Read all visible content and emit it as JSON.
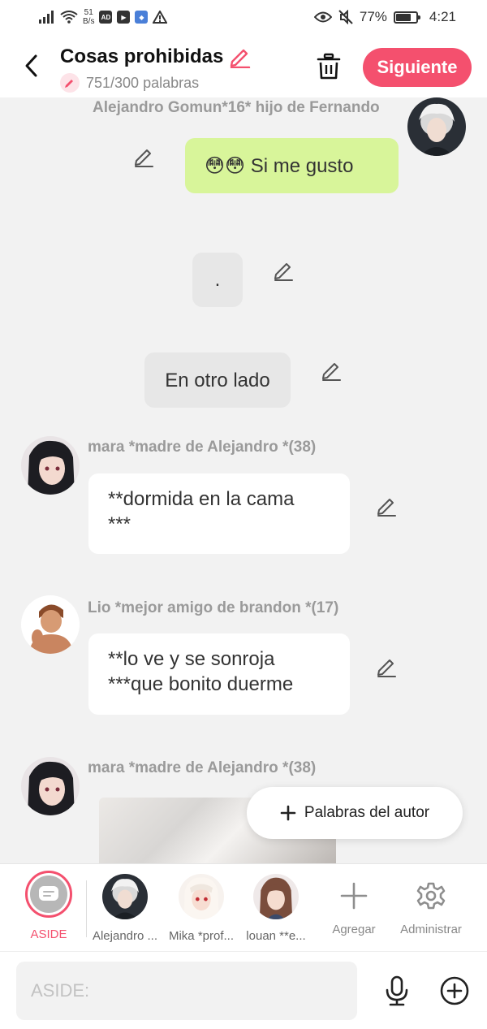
{
  "status_bar": {
    "net_speed_value": "51",
    "net_speed_unit": "B/s",
    "app_icon_1": "AD",
    "battery": "77%",
    "time": "4:21"
  },
  "header": {
    "title": "Cosas prohibidas",
    "word_count": "751/300 palabras",
    "next_label": "Siguiente"
  },
  "messages": [
    {
      "speaker": "Alejandro Gomun*16* hijo de Fernando",
      "text": "😳😳 Si me gusto"
    },
    {
      "text": "."
    },
    {
      "text": "En otro lado"
    },
    {
      "speaker": "mara *madre de Alejandro *(38)",
      "line1": "**dormida en la cama",
      "line2": "***"
    },
    {
      "speaker": "Lio *mejor amigo de brandon *(17)",
      "line1": "**lo ve y se sonroja",
      "line2": "***que bonito duerme"
    },
    {
      "speaker": "mara *madre de Alejandro *(38)"
    }
  ],
  "fab": {
    "label": "Palabras del autor"
  },
  "characters": [
    {
      "label": "ASIDE"
    },
    {
      "label": "Alejandro ..."
    },
    {
      "label": "Mika *prof..."
    },
    {
      "label": "louan **e..."
    },
    {
      "label": "Agregar"
    },
    {
      "label": "Administrar"
    }
  ],
  "input": {
    "placeholder": "ASIDE:"
  },
  "colors": {
    "accent": "#f4506e",
    "green_bubble": "#d8f59a",
    "grey_bubble": "#e7e7e7",
    "background": "#f2f2f2"
  },
  "icons": [
    "back-icon",
    "edit-icon",
    "trash-icon",
    "pencil-icon",
    "plus-icon",
    "gear-icon",
    "microphone-icon",
    "add-circle-icon"
  ]
}
